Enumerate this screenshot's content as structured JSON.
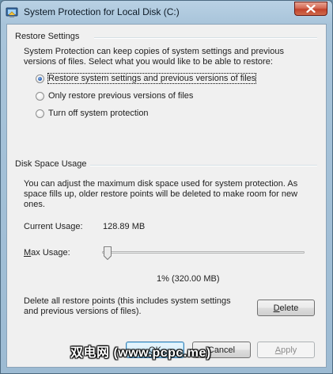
{
  "window": {
    "title": "System Protection for Local Disk (C:)",
    "icon": "system-protection-icon",
    "close_icon": "close-icon"
  },
  "restore_settings": {
    "heading": "Restore Settings",
    "description_line1": "System Protection can keep copies of system settings and previous",
    "description_line2": "versions of files. Select what you would like to be able to restore:",
    "options": [
      {
        "label": "Restore system settings and previous versions of files",
        "selected": true
      },
      {
        "label": "Only restore previous versions of files",
        "selected": false
      },
      {
        "label": "Turn off system protection",
        "selected": false
      }
    ]
  },
  "disk_space": {
    "heading": "Disk Space Usage",
    "description_line1": "You can adjust the maximum disk space used for system protection. As",
    "description_line2": "space fills up, older restore points will be deleted to make room for new",
    "description_line3": "ones.",
    "current_usage_label": "Current Usage:",
    "current_usage_value": "128.89 MB",
    "max_usage_label_prefix": "M",
    "max_usage_label_rest": "ax Usage:",
    "max_usage_fraction": 0.01,
    "max_usage_readout": "1% (320.00 MB)",
    "delete_text_line1": "Delete all restore points (this includes system settings",
    "delete_text_line2": "and previous versions of files).",
    "delete_button_prefix": "D",
    "delete_button_rest": "elete"
  },
  "buttons": {
    "ok": "OK",
    "cancel": "Cancel",
    "apply_prefix": "A",
    "apply_rest": "pply"
  },
  "watermark": "双电网 (www.pcpc.me)",
  "colors": {
    "frame": "#a8c4da",
    "close_button": "#c2432b",
    "radio_selected": "#2a63b8",
    "default_button_border": "#3c7fb1"
  }
}
